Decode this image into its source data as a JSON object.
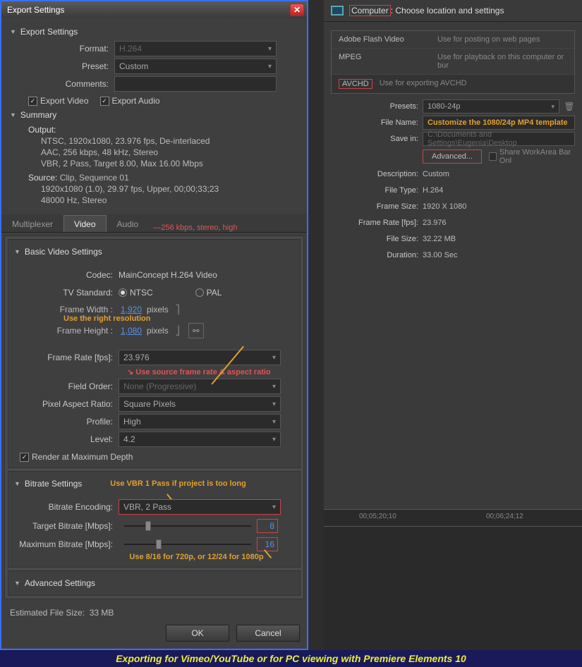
{
  "dialog": {
    "title": "Export Settings",
    "sections": {
      "export_settings": "Export Settings",
      "summary": "Summary",
      "basic_video": "Basic Video Settings",
      "bitrate": "Bitrate Settings",
      "advanced": "Advanced Settings"
    },
    "format_label": "Format:",
    "format_value": "H.264",
    "preset_label": "Preset:",
    "preset_value": "Custom",
    "comments_label": "Comments:",
    "comments_value": "",
    "export_video": "Export Video",
    "export_audio": "Export Audio",
    "summary_output_label": "Output:",
    "summary_output_l1": "NTSC, 1920x1080, 23.976 fps, De-interlaced",
    "summary_output_l2": "AAC, 256 kbps, 48 kHz, Stereo",
    "summary_output_l3": "VBR, 2 Pass, Target 8.00, Max 16.00 Mbps",
    "summary_source_label": "Source:",
    "summary_source_l1": "Clip, Sequence 01",
    "summary_source_l2": "1920x1080 (1.0), 29.97 fps, Upper, 00;00;33;23",
    "summary_source_l3": "48000 Hz, Stereo",
    "tabs": {
      "multiplexer": "Multiplexer",
      "video": "Video",
      "audio": "Audio"
    },
    "tab_note": "256 kbps, stereo, high",
    "codec_label": "Codec:",
    "codec_value": "MainConcept H.264 Video",
    "tvstd_label": "TV Standard:",
    "tvstd_ntsc": "NTSC",
    "tvstd_pal": "PAL",
    "fw_label": "Frame Width :",
    "fw_value": "1,920",
    "fh_label": "Frame Height :",
    "fh_value": "1,080",
    "px_unit": "pixels",
    "anno_resolution": "Use the right resolution",
    "fr_label": "Frame Rate [fps]:",
    "fr_value": "23.976",
    "anno_framerate": "Use source frame rate & aspect ratio",
    "fo_label": "Field Order:",
    "fo_value": "None (Progressive)",
    "par_label": "Pixel Aspect Ratio:",
    "par_value": "Square Pixels",
    "profile_label": "Profile:",
    "profile_value": "High",
    "level_label": "Level:",
    "level_value": "4.2",
    "render_depth": "Render at Maximum Depth",
    "anno_vbr": "Use VBR 1 Pass if project is too long",
    "be_label": "Bitrate Encoding:",
    "be_value": "VBR, 2 Pass",
    "tb_label": "Target Bitrate [Mbps]:",
    "tb_value": "8",
    "mb_label": "Maximum Bitrate [Mbps]:",
    "mb_value": "16",
    "anno_bitrate": "Use 8/16 for 720p, or 12/24 for 1080p",
    "est_label": "Estimated File Size:",
    "est_value": "33 MB",
    "ok": "OK",
    "cancel": "Cancel"
  },
  "right": {
    "header_computer": "Computer",
    "header_rest": ": Choose location and settings",
    "options": [
      {
        "name": "Adobe Flash Video",
        "desc": "Use for posting on web pages"
      },
      {
        "name": "MPEG",
        "desc": "Use for playback on this computer or bur"
      },
      {
        "name": "AVCHD",
        "desc": "Use for exporting AVCHD"
      }
    ],
    "presets_label": "Presets:",
    "presets_value": "1080-24p",
    "filename_label": "File Name:",
    "filename_value": "Customize the 1080/24p MP4 template",
    "savein_label": "Save in:",
    "savein_value": "C:\\Documents and Settings\\Eugenia\\Desktop",
    "advanced_btn": "Advanced...",
    "share_workarea": "Share WorkArea Bar Onl",
    "desc_label": "Description:",
    "desc_value": "Custom",
    "filetype_label": "File Type:",
    "filetype_value": "H.264",
    "framesize_label": "Frame Size:",
    "framesize_value": "1920 X 1080",
    "framerate_label": "Frame Rate [fps]:",
    "framerate_value": "23.976",
    "filesize_label": "File Size:",
    "filesize_value": "32.22 MB",
    "duration_label": "Duration:",
    "duration_value": "33.00 Sec",
    "tc1": "00;05;20;10",
    "tc2": "00;06;24;12"
  },
  "banner": "Exporting for Vimeo/YouTube or for PC viewing with Premiere Elements 10"
}
